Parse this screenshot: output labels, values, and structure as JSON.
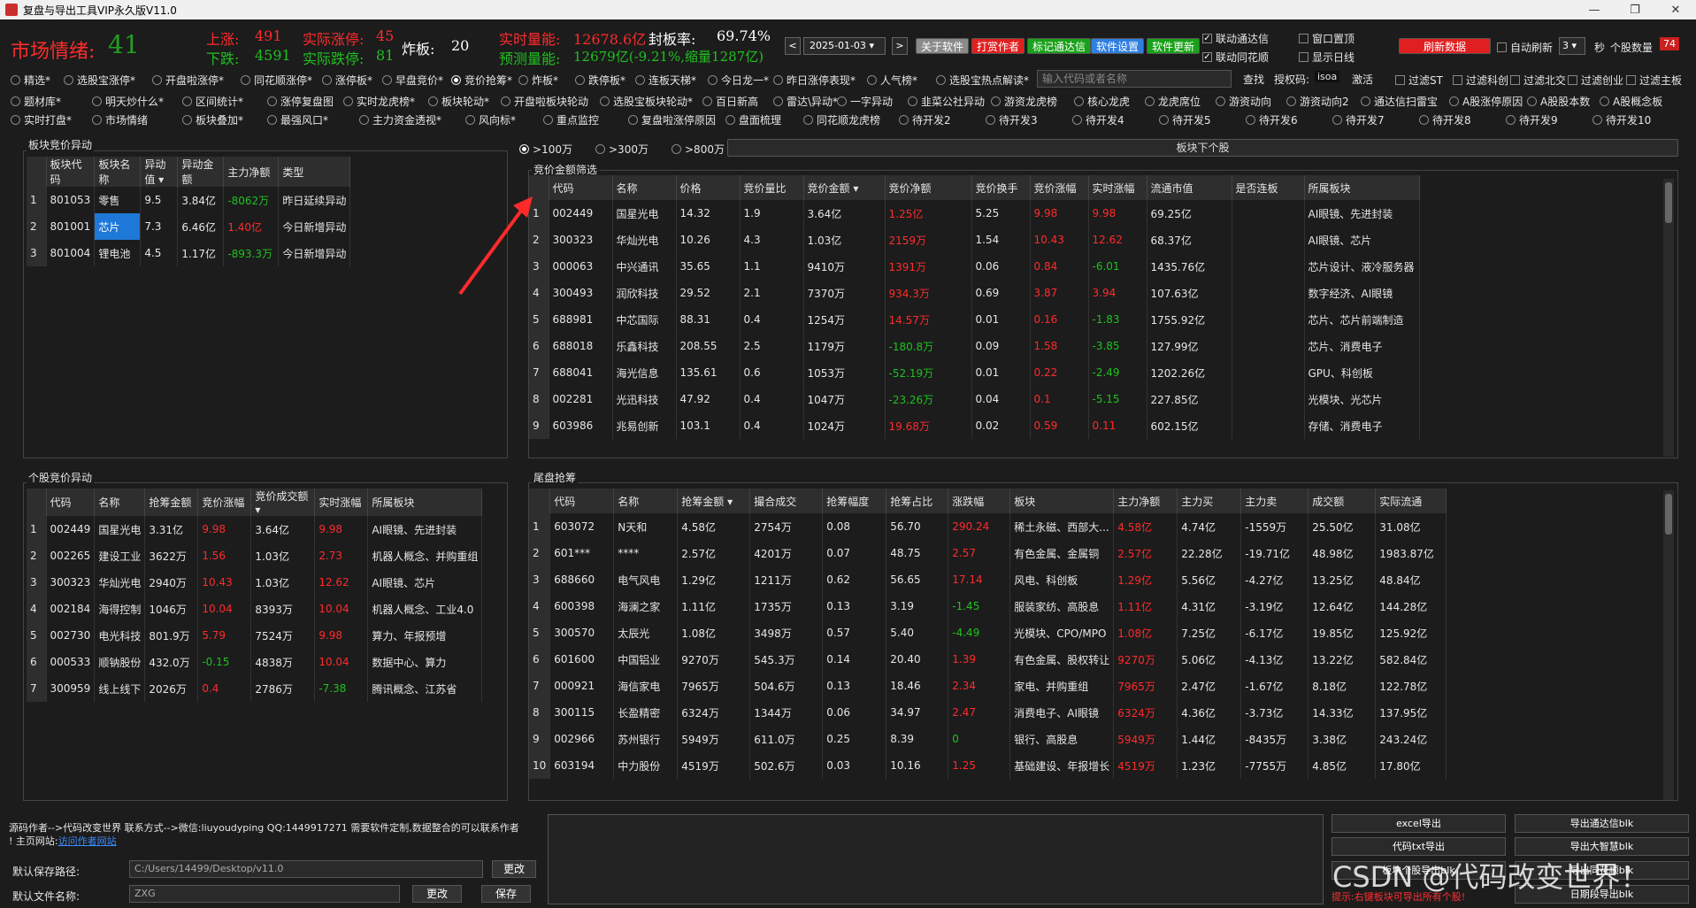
{
  "window": {
    "title": "复盘与导出工具VIP永久版V11.0",
    "controls": [
      "—",
      "❐",
      "✕"
    ]
  },
  "stats": {
    "mood_label": "市场情绪:",
    "mood_value": "41",
    "up_label": "上涨:",
    "up_value": "491",
    "down_label": "下跌:",
    "down_value": "4591",
    "real_up_label": "实际涨停:",
    "real_up_value": "45",
    "real_down_label": "实际跌停:",
    "real_down_value": "81",
    "blow_label": "炸板:",
    "blow_value": "20",
    "volume_label": "实时量能:",
    "volume_value": "12678.6亿",
    "forecast_label": "预测量能:",
    "forecast_value": "12679亿(-9.21%,缩量1287亿)",
    "seal_label": "封板率:",
    "seal_value": "69.74%"
  },
  "toolbar": {
    "prev": "<",
    "next": ">",
    "date": "2025-01-03",
    "about": "关于软件",
    "reward": "打赏作者",
    "mark_tdx": "标记通达信",
    "settings": "软件设置",
    "update": "软件更新",
    "refresh": "刷新数据",
    "link_tdx": "联动通达信",
    "link_ths": "联动同花顺",
    "window_top": "窗口置顶",
    "show_kline": "显示日线",
    "auto_refresh": "自动刷新",
    "refresh_interval": "3",
    "refresh_unit": "秒",
    "stock_count_label": "个股数量",
    "stock_count": "74"
  },
  "filters": {
    "row1": [
      "精选*",
      "选股宝涨停*",
      "开盘啦涨停*",
      "同花顺涨停*",
      "涨停板*",
      "早盘竞价*",
      "竞价抢筹*",
      "炸板*",
      "跌停板*",
      "连板天梯*",
      "今日龙一*",
      "昨日涨停表现*",
      "人气榜*",
      "选股宝热点解读*"
    ],
    "row1_selected": "竞价抢筹*",
    "search_placeholder": "输入代码或者名称",
    "search_button": "查找",
    "auth_label": "授权码:",
    "auth_code": "isoa",
    "activate": "激活",
    "row1_checks": [
      "过滤ST",
      "过滤科创",
      "过滤北交",
      "过滤创业",
      "过滤主板"
    ],
    "row2": [
      "题材库*",
      "明天炒什么*",
      "区间统计*",
      "涨停复盘图",
      "实时龙虎榜*",
      "板块轮动*",
      "开盘啦板块轮动",
      "选股宝板块轮动*",
      "百日新高",
      "雷达\\异动*",
      "一字异动",
      "韭菜公社异动",
      "游资龙虎榜",
      "核心龙虎",
      "龙虎席位",
      "游资动向",
      "游资动向2",
      "通达信扫雷宝",
      "A股涨停原因",
      "A股股本数",
      "A股概念板"
    ],
    "row3": [
      "实时打盘*",
      "市场情绪",
      "板块叠加*",
      "最强风口*",
      "主力资金透视*",
      "风向标*",
      "重点监控",
      "复盘啦涨停原因",
      "盘面梳理",
      "同花顺龙虎榜",
      "待开发2",
      "待开发3",
      "待开发4",
      "待开发5",
      "待开发6",
      "待开发7",
      "待开发8",
      "待开发9",
      "待开发10"
    ]
  },
  "amount_filter": {
    "options": [
      ">100万",
      ">300万",
      ">800万"
    ],
    "selected": ">100万",
    "next_button": "板块下个股"
  },
  "sector_panel": {
    "title": "板块竞价异动",
    "headers": [
      "板块代码",
      "板块名称",
      "异动值",
      "异动金额",
      "主力净额",
      "类型"
    ],
    "rows": [
      {
        "i": "1",
        "code": "801053",
        "name": "零售",
        "val": "9.5",
        "amt": "3.84亿",
        "net": "-8062万",
        "type": "昨日延续异动"
      },
      {
        "i": "2",
        "code": "801001",
        "name": "芯片",
        "val": "7.3",
        "amt": "6.46亿",
        "net": "1.40亿",
        "type": "今日新增异动"
      },
      {
        "i": "3",
        "code": "801004",
        "name": "锂电池",
        "val": "4.5",
        "amt": "1.17亿",
        "net": "-893.3万",
        "type": "今日新增异动"
      }
    ]
  },
  "auction_panel": {
    "title": "竞价金额筛选",
    "headers": [
      "代码",
      "名称",
      "价格",
      "竞价量比",
      "竞价金额",
      "竞价净额",
      "竞价换手",
      "竞价涨幅",
      "实时涨幅",
      "流通市值",
      "是否连板",
      "所属板块"
    ],
    "rows": [
      {
        "i": "1",
        "code": "002449",
        "name": "国星光电",
        "price": "14.32",
        "ratio": "1.9",
        "amt": "3.64亿",
        "net": "1.25亿",
        "turn": "5.25",
        "ap": "9.98",
        "rp": "9.98",
        "mv": "69.25亿",
        "lb": "",
        "sec": "AI眼镜、先进封装"
      },
      {
        "i": "2",
        "code": "300323",
        "name": "华灿光电",
        "price": "10.26",
        "ratio": "4.3",
        "amt": "1.03亿",
        "net": "2159万",
        "turn": "1.54",
        "ap": "10.43",
        "rp": "12.62",
        "mv": "68.37亿",
        "lb": "",
        "sec": "AI眼镜、芯片"
      },
      {
        "i": "3",
        "code": "000063",
        "name": "中兴通讯",
        "price": "35.65",
        "ratio": "1.1",
        "amt": "9410万",
        "net": "1391万",
        "turn": "0.06",
        "ap": "0.84",
        "rp": "-6.01",
        "mv": "1435.76亿",
        "lb": "",
        "sec": "芯片设计、液冷服务器"
      },
      {
        "i": "4",
        "code": "300493",
        "name": "润欣科技",
        "price": "29.52",
        "ratio": "2.1",
        "amt": "7370万",
        "net": "934.3万",
        "turn": "0.69",
        "ap": "3.87",
        "rp": "3.94",
        "mv": "107.63亿",
        "lb": "",
        "sec": "数字经济、AI眼镜"
      },
      {
        "i": "5",
        "code": "688981",
        "name": "中芯国际",
        "price": "88.31",
        "ratio": "0.4",
        "amt": "1254万",
        "net": "14.57万",
        "turn": "0.01",
        "ap": "0.16",
        "rp": "-1.83",
        "mv": "1755.92亿",
        "lb": "",
        "sec": "芯片、芯片前端制造"
      },
      {
        "i": "6",
        "code": "688018",
        "name": "乐鑫科技",
        "price": "208.55",
        "ratio": "2.5",
        "amt": "1179万",
        "net": "-180.8万",
        "turn": "0.09",
        "ap": "1.58",
        "rp": "-3.85",
        "mv": "127.99亿",
        "lb": "",
        "sec": "芯片、消费电子"
      },
      {
        "i": "7",
        "code": "688041",
        "name": "海光信息",
        "price": "135.61",
        "ratio": "0.6",
        "amt": "1053万",
        "net": "-52.19万",
        "turn": "0.01",
        "ap": "0.22",
        "rp": "-2.49",
        "mv": "1202.26亿",
        "lb": "",
        "sec": "GPU、科创板"
      },
      {
        "i": "8",
        "code": "002281",
        "name": "光迅科技",
        "price": "47.92",
        "ratio": "0.4",
        "amt": "1047万",
        "net": "-23.26万",
        "turn": "0.04",
        "ap": "0.1",
        "rp": "-5.15",
        "mv": "227.85亿",
        "lb": "",
        "sec": "光模块、光芯片"
      },
      {
        "i": "9",
        "code": "603986",
        "name": "兆易创新",
        "price": "103.1",
        "ratio": "0.4",
        "amt": "1024万",
        "net": "19.68万",
        "turn": "0.02",
        "ap": "0.59",
        "rp": "0.11",
        "mv": "602.15亿",
        "lb": "",
        "sec": "存储、消费电子"
      }
    ]
  },
  "stock_panel": {
    "title": "个股竞价异动",
    "headers": [
      "代码",
      "名称",
      "抢筹金额",
      "竞价涨幅",
      "竞价成交额",
      "实时涨幅",
      "所属板块"
    ],
    "rows": [
      {
        "i": "1",
        "code": "002449",
        "name": "国星光电",
        "amt": "3.31亿",
        "ap": "9.98",
        "vol": "3.64亿",
        "rp": "9.98",
        "sec": "AI眼镜、先进封装"
      },
      {
        "i": "2",
        "code": "002265",
        "name": "建设工业",
        "amt": "3622万",
        "ap": "1.56",
        "vol": "1.03亿",
        "rp": "2.73",
        "sec": "机器人概念、并购重组"
      },
      {
        "i": "3",
        "code": "300323",
        "name": "华灿光电",
        "amt": "2940万",
        "ap": "10.43",
        "vol": "1.03亿",
        "rp": "12.62",
        "sec": "AI眼镜、芯片"
      },
      {
        "i": "4",
        "code": "002184",
        "name": "海得控制",
        "amt": "1046万",
        "ap": "10.04",
        "vol": "8393万",
        "rp": "10.04",
        "sec": "机器人概念、工业4.0"
      },
      {
        "i": "5",
        "code": "002730",
        "name": "电光科技",
        "amt": "801.9万",
        "ap": "5.79",
        "vol": "7524万",
        "rp": "9.98",
        "sec": "算力、年报预增"
      },
      {
        "i": "6",
        "code": "000533",
        "name": "顺钠股份",
        "amt": "432.0万",
        "ap": "-0.15",
        "vol": "4838万",
        "rp": "10.04",
        "sec": "数据中心、算力"
      },
      {
        "i": "7",
        "code": "300959",
        "name": "线上线下",
        "amt": "2026万",
        "ap": "0.4",
        "vol": "2786万",
        "rp": "-7.38",
        "sec": "腾讯概念、江苏省"
      }
    ]
  },
  "tail_panel": {
    "title": "尾盘抢筹",
    "headers": [
      "代码",
      "名称",
      "抢筹金额",
      "撮合成交",
      "抢筹幅度",
      "抢筹占比",
      "涨跌幅",
      "板块",
      "主力净额",
      "主力买",
      "主力卖",
      "成交额",
      "实际流通"
    ],
    "rows": [
      {
        "i": "1",
        "code": "603072",
        "name": "N天和",
        "amt": "4.58亿",
        "deal": "2754万",
        "rng": "0.08",
        "pct": "56.70",
        "chg": "290.24",
        "sec": "稀土永磁、西部大...",
        "net": "4.58亿",
        "buy": "4.74亿",
        "sell": "-1559万",
        "vol": "25.50亿",
        "flow": "31.08亿"
      },
      {
        "i": "2",
        "code": "601***",
        "name": "****",
        "amt": "2.57亿",
        "deal": "4201万",
        "rng": "0.07",
        "pct": "48.75",
        "chg": "2.57",
        "sec": "有色金属、金属铜",
        "net": "2.57亿",
        "buy": "22.28亿",
        "sell": "-19.71亿",
        "vol": "48.98亿",
        "flow": "1983.87亿"
      },
      {
        "i": "3",
        "code": "688660",
        "name": "电气风电",
        "amt": "1.29亿",
        "deal": "1211万",
        "rng": "0.62",
        "pct": "56.65",
        "chg": "17.14",
        "sec": "风电、科创板",
        "net": "1.29亿",
        "buy": "5.56亿",
        "sell": "-4.27亿",
        "vol": "13.25亿",
        "flow": "48.84亿"
      },
      {
        "i": "4",
        "code": "600398",
        "name": "海澜之家",
        "amt": "1.11亿",
        "deal": "1735万",
        "rng": "0.13",
        "pct": "3.19",
        "chg": "-1.45",
        "sec": "服装家纺、高股息",
        "net": "1.11亿",
        "buy": "4.31亿",
        "sell": "-3.19亿",
        "vol": "12.64亿",
        "flow": "144.28亿"
      },
      {
        "i": "5",
        "code": "300570",
        "name": "太辰光",
        "amt": "1.08亿",
        "deal": "3498万",
        "rng": "0.57",
        "pct": "5.40",
        "chg": "-4.49",
        "sec": "光模块、CPO/MPO",
        "net": "1.08亿",
        "buy": "7.25亿",
        "sell": "-6.17亿",
        "vol": "19.85亿",
        "flow": "125.92亿"
      },
      {
        "i": "6",
        "code": "601600",
        "name": "中国铝业",
        "amt": "9270万",
        "deal": "545.3万",
        "rng": "0.14",
        "pct": "20.40",
        "chg": "1.39",
        "sec": "有色金属、股权转让",
        "net": "9270万",
        "buy": "5.06亿",
        "sell": "-4.13亿",
        "vol": "13.22亿",
        "flow": "582.84亿"
      },
      {
        "i": "7",
        "code": "000921",
        "name": "海信家电",
        "amt": "7965万",
        "deal": "504.6万",
        "rng": "0.13",
        "pct": "18.46",
        "chg": "2.34",
        "sec": "家电、并购重组",
        "net": "7965万",
        "buy": "2.47亿",
        "sell": "-1.67亿",
        "vol": "8.18亿",
        "flow": "122.78亿"
      },
      {
        "i": "8",
        "code": "300115",
        "name": "长盈精密",
        "amt": "6324万",
        "deal": "1344万",
        "rng": "0.06",
        "pct": "34.97",
        "chg": "2.47",
        "sec": "消费电子、AI眼镜",
        "net": "6324万",
        "buy": "4.36亿",
        "sell": "-3.73亿",
        "vol": "14.33亿",
        "flow": "137.95亿"
      },
      {
        "i": "9",
        "code": "002966",
        "name": "苏州银行",
        "amt": "5949万",
        "deal": "611.0万",
        "rng": "0.25",
        "pct": "8.39",
        "chg": "0",
        "sec": "银行、高股息",
        "net": "5949万",
        "buy": "1.44亿",
        "sell": "-8435万",
        "vol": "3.38亿",
        "flow": "243.24亿"
      },
      {
        "i": "10",
        "code": "603194",
        "name": "中力股份",
        "amt": "4519万",
        "deal": "502.6万",
        "rng": "0.03",
        "pct": "10.16",
        "chg": "1.25",
        "sec": "基础建设、年报增长",
        "net": "4519万",
        "buy": "1.23亿",
        "sell": "-7755万",
        "vol": "4.85亿",
        "flow": "17.80亿"
      }
    ]
  },
  "bottom": {
    "author_info": "源码作者-->代码改变世界 联系方式-->微信:liuyoudyping QQ:1449917271 需要软件定制,数据整合的可以联系作者",
    "site_label": "! 主页网站:",
    "site_link": "访问作者网站",
    "save_path_label": "默认保存路径:",
    "save_path": "C:/Users/14499/Desktop/v11.0",
    "file_name_label": "默认文件名称:",
    "file_name": "ZXG",
    "change": "更改",
    "change2": "更改",
    "save": "保存",
    "export_excel": "excel导出",
    "export_tdx_blk": "导出通达信blk",
    "export_txt": "代码txt导出",
    "export_dzh": "导出大智慧blk",
    "export_sector": "板块个股导出blk",
    "export_ths": "导出同花顺blk",
    "export_date": "日期段导出blk",
    "tip": "提示:右键板块可导出所有个股!"
  },
  "watermark": "CSDN @代码改变世界！",
  "colors": {
    "up": "#ff2b2b",
    "down": "#20c020",
    "selected": "#1e78d7",
    "background": "#1c1c1c"
  }
}
